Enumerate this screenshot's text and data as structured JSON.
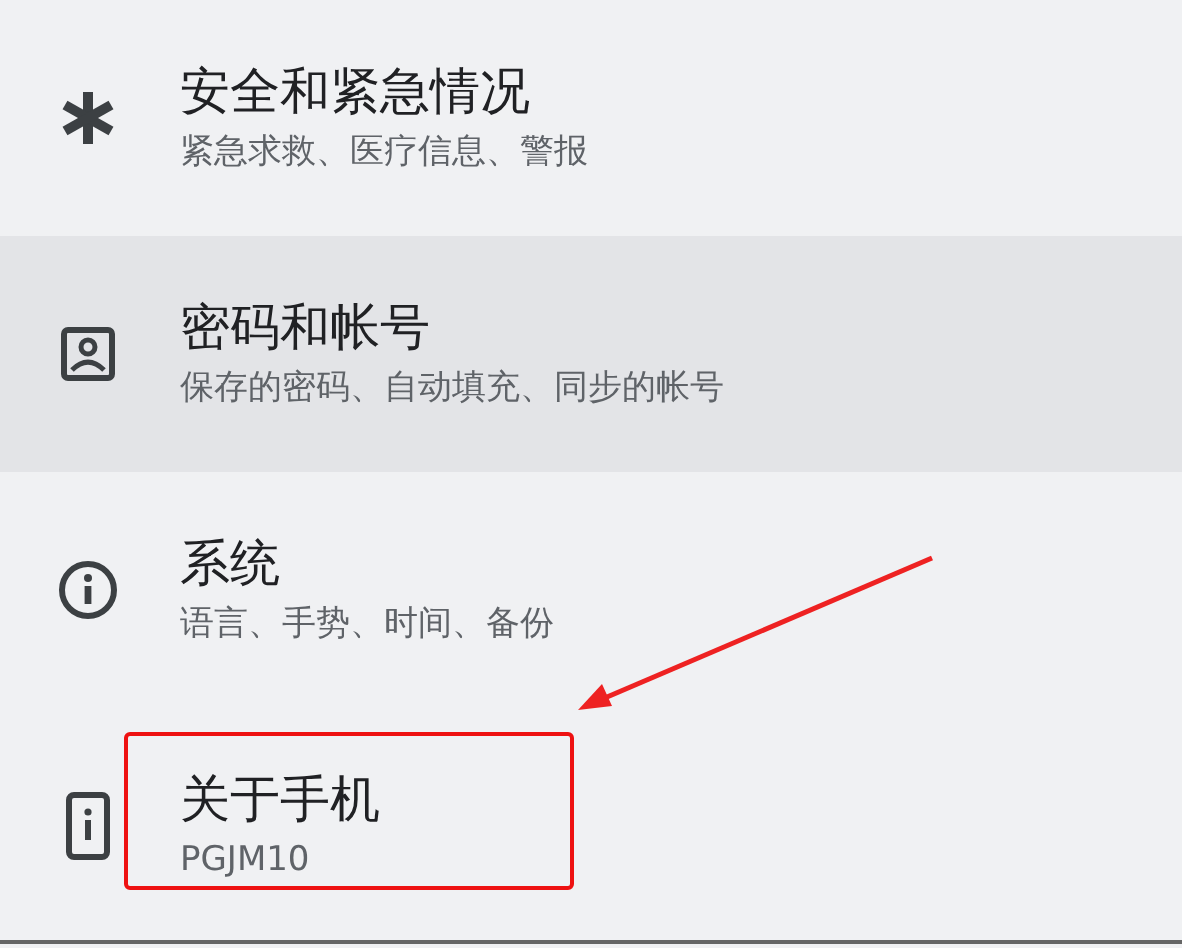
{
  "settings_items": [
    {
      "kind": "asterisk",
      "title": "安全和紧急情况",
      "subtitle": "紧急求救、医疗信息、警报",
      "selected": false
    },
    {
      "kind": "account",
      "title": "密码和帐号",
      "subtitle": "保存的密码、自动填充、同步的帐号",
      "selected": true
    },
    {
      "kind": "info",
      "title": "系统",
      "subtitle": "语言、手势、时间、备份",
      "selected": false
    },
    {
      "kind": "phone",
      "title": "关于手机",
      "subtitle": "PGJM10",
      "selected": false
    }
  ]
}
